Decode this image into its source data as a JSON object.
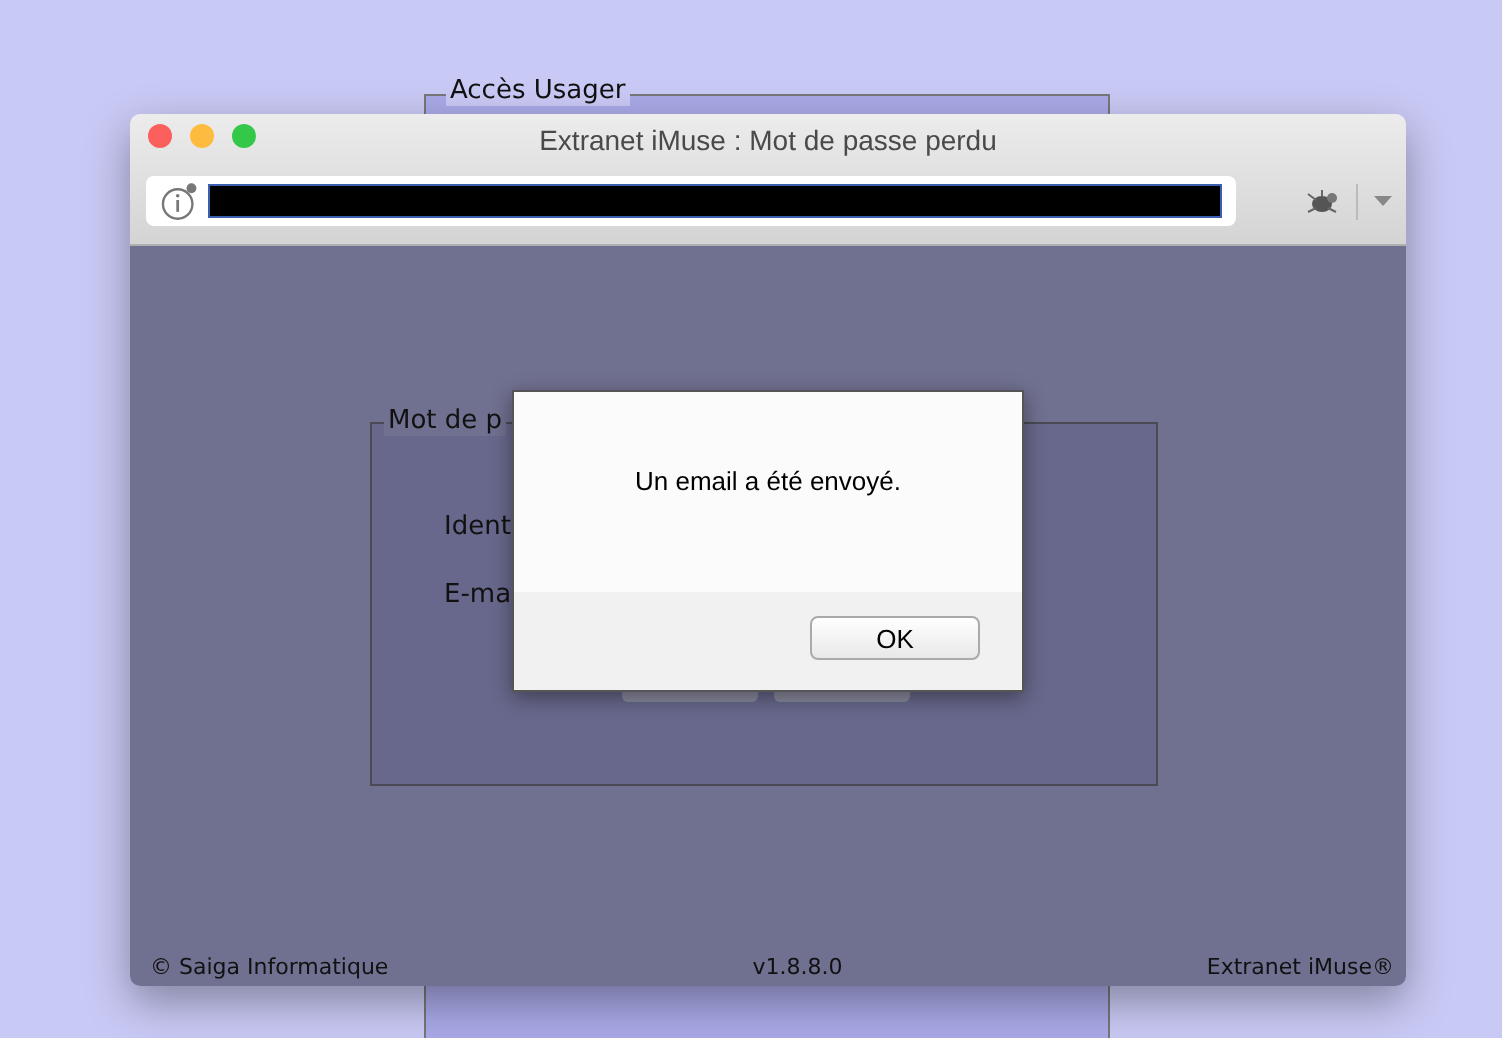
{
  "background_panel": {
    "legend": "Accès Usager"
  },
  "window": {
    "title": "Extranet iMuse : Mot de passe perdu"
  },
  "form": {
    "legend": "Mot de p",
    "fields": [
      {
        "label": "Ident"
      },
      {
        "label": "E-ma"
      }
    ]
  },
  "footer": {
    "left": "© Saiga Informatique",
    "center": "v1.8.8.0",
    "right": "Extranet iMuse®"
  },
  "dialog": {
    "message": "Un email a été envoyé.",
    "buttons": [
      "OK"
    ]
  }
}
